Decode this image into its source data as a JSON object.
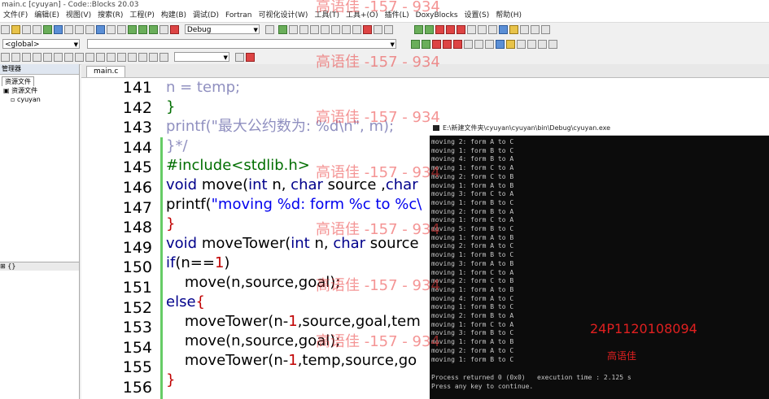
{
  "window": {
    "title": "main.c [cyuyan] - Code::Blocks 20.03"
  },
  "menu": [
    "文件(F)",
    "编辑(E)",
    "视图(V)",
    "搜索(R)",
    "工程(P)",
    "构建(B)",
    "调试(D)",
    "Fortran",
    "可视化设计(W)",
    "工具(T)",
    "工具+(O)",
    "插件(L)",
    "DoxyBlocks",
    "设置(S)",
    "帮助(H)"
  ],
  "toolbar": {
    "build_target": "Debug",
    "scope": "<global>"
  },
  "left_panel": {
    "header": "管理器",
    "tab": "资源文件",
    "tree_root": "资源文件",
    "tree_child": "cyuyan",
    "bottom_item": "{}"
  },
  "editor": {
    "tab": "main.c",
    "line_numbers": [
      "141",
      "142",
      "143",
      "144",
      "145",
      "146",
      "147",
      "148",
      "149",
      "150",
      "151",
      "152",
      "153",
      "154",
      "155",
      "156"
    ]
  },
  "console": {
    "title": "E:\\新建文件夹\\cyuyan\\cyuyan\\bin\\Debug\\cyuyan.exe",
    "lines": [
      "moving 2: form A to C",
      "moving 1: form B to C",
      "moving 4: form B to A",
      "moving 1: form C to A",
      "moving 2: form C to B",
      "moving 1: form A to B",
      "moving 3: form C to A",
      "moving 1: form B to C",
      "moving 2: form B to A",
      "moving 1: form C to A",
      "moving 5: form B to C",
      "moving 1: form A to B",
      "moving 2: form A to C",
      "moving 1: form B to C",
      "moving 3: form A to B",
      "moving 1: form C to A",
      "moving 2: form C to B",
      "moving 1: form A to B",
      "moving 4: form A to C",
      "moving 1: form B to C",
      "moving 2: form B to A",
      "moving 1: form C to A",
      "moving 3: form B to C",
      "moving 1: form A to B",
      "moving 2: form A to C",
      "moving 1: form B to C"
    ],
    "footer1": "Process returned 0 (0x0)   execution time : 2.125 s",
    "footer2": "Press any key to continue."
  },
  "overlay": {
    "id": "24P1120108094",
    "name": "高语佳",
    "watermark": "高语佳 -157 - 934"
  },
  "colors": {
    "keyword": "#00008b",
    "preprocessor": "#006e00",
    "string": "#0000ee",
    "comment": "#9090c0",
    "brace": "#c00000"
  }
}
